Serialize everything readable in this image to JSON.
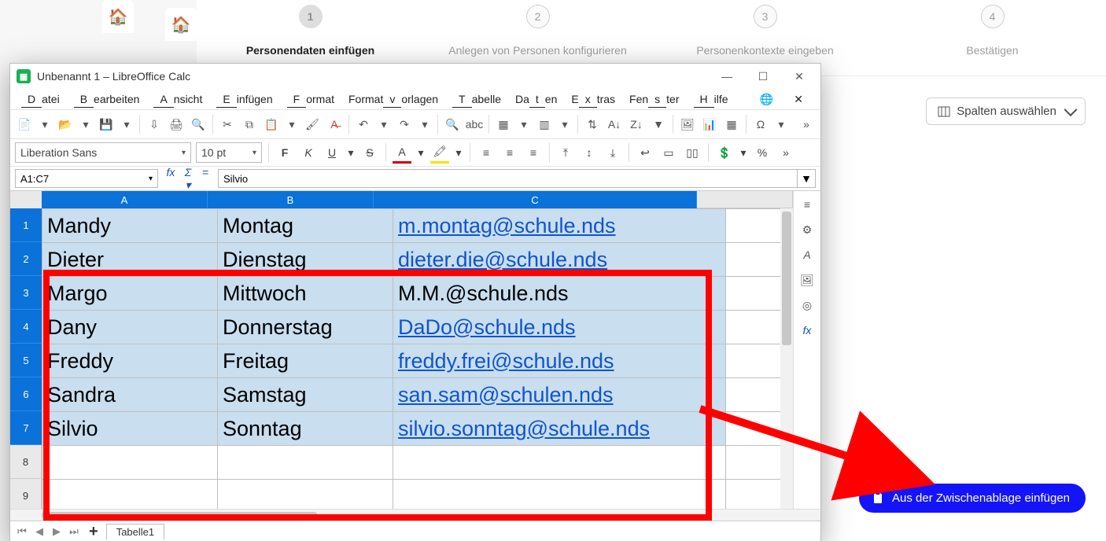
{
  "wizard": {
    "steps": [
      {
        "num": "1",
        "label": "Personendaten einfügen"
      },
      {
        "num": "2",
        "label": "Anlegen von Personen konfigurieren"
      },
      {
        "num": "3",
        "label": "Personenkontexte eingeben"
      },
      {
        "num": "4",
        "label": "Bestätigen"
      }
    ],
    "columns_btn": "Spalten auswählen",
    "clipboard_btn": "Aus der Zwischenablage einfügen"
  },
  "calc": {
    "title": "Unbenannt 1 – LibreOffice Calc",
    "menu": [
      "Datei",
      "Bearbeiten",
      "Ansicht",
      "Einfügen",
      "Format",
      "Formatvorlagen",
      "Tabelle",
      "Daten",
      "Extras",
      "Fenster",
      "Hilfe"
    ],
    "font_name": "Liberation Sans",
    "font_size": "10 pt",
    "name_box": "A1:C7",
    "formula": "Silvio",
    "sheet_tab": "Tabelle1",
    "col_widths": {
      "A": 210,
      "B": 210,
      "C": 410,
      "D": 70
    },
    "columns": [
      "A",
      "B",
      "C"
    ],
    "rows": [
      {
        "A": "Mandy",
        "B": "Montag",
        "C": "m.montag@schule.nds",
        "link": true
      },
      {
        "A": "Dieter",
        "B": "Dienstag",
        "C": "dieter.die@schule.nds",
        "link": true
      },
      {
        "A": "Margo",
        "B": "Mittwoch",
        "C": "M.M.@schule.nds",
        "link": false
      },
      {
        "A": "Dany",
        "B": "Donnerstag",
        "C": "DaDo@schule.nds",
        "link": true
      },
      {
        "A": "Freddy",
        "B": "Freitag",
        "C": "freddy.frei@schule.nds",
        "link": true
      },
      {
        "A": "Sandra",
        "B": "Samstag",
        "C": "san.sam@schulen.nds",
        "link": true
      },
      {
        "A": "Silvio",
        "B": "Sonntag",
        "C": "silvio.sonntag@schule.nds",
        "link": true
      }
    ],
    "extra_rows": [
      "8",
      "9"
    ]
  }
}
